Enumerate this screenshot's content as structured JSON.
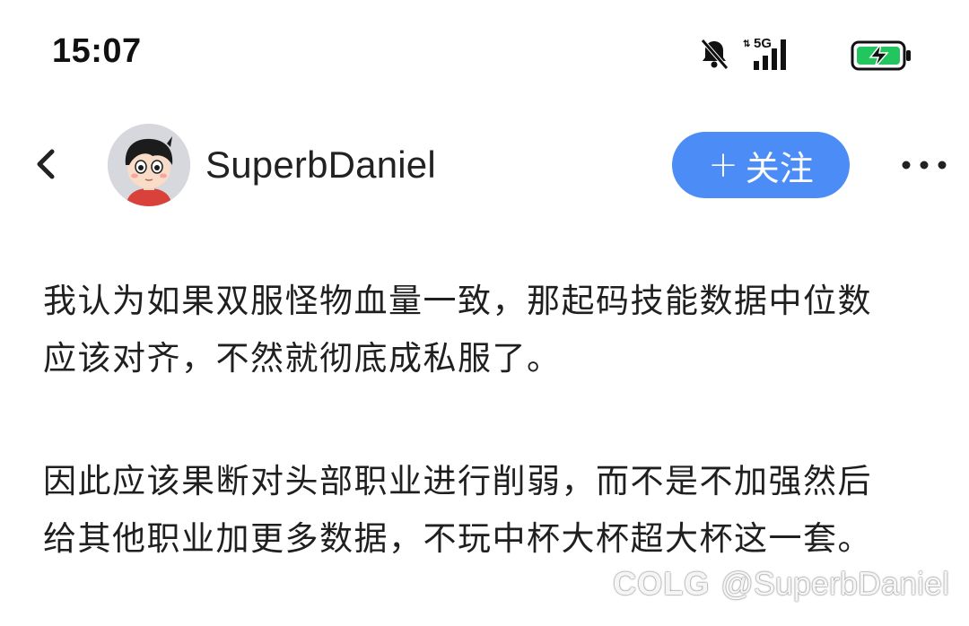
{
  "status_bar": {
    "time": "15:07",
    "network": "5G",
    "icons": [
      "bell-muted-icon",
      "signal-icon",
      "battery-charging-icon"
    ],
    "battery_color": "#22c55e"
  },
  "header": {
    "back_icon": "chevron-left-icon",
    "username": "SuperbDaniel",
    "follow_plus": "+",
    "follow_label": "关注",
    "more_icon": "more-icon",
    "accent": "#4b8cf7"
  },
  "post": {
    "paragraph1": [
      "我认为如果双服怪物血量一致，那起码技能数据中位数",
      "应该对齐，不然就彻底成私服了。"
    ],
    "paragraph2": [
      "因此应该果断对头部职业进行削弱，而不是不加强然后",
      "给其他职业加更多数据，不玩中杯大杯超大杯这一套。"
    ]
  },
  "watermark": {
    "logo": "COLG",
    "handle": "@SuperbDaniel"
  }
}
